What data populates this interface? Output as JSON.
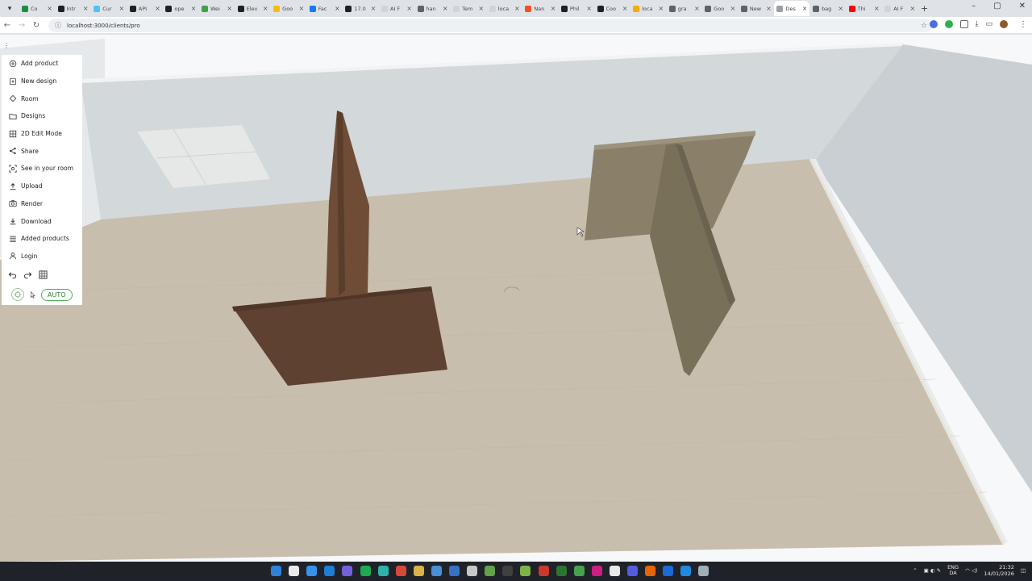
{
  "browser": {
    "tabs": [
      {
        "label": "Co",
        "color": "#1e8e3e"
      },
      {
        "label": "Intr",
        "color": "#202124"
      },
      {
        "label": "Cur",
        "color": "#4fc3f7"
      },
      {
        "label": "API",
        "color": "#202124"
      },
      {
        "label": "ope",
        "color": "#202124"
      },
      {
        "label": "Wei",
        "color": "#43a047"
      },
      {
        "label": "Elev",
        "color": "#202124"
      },
      {
        "label": "Goo",
        "color": "#fbbc04"
      },
      {
        "label": "Fac",
        "color": "#1877f2"
      },
      {
        "label": "17.0",
        "color": "#202124"
      },
      {
        "label": "AI F",
        "color": "#cfd4da"
      },
      {
        "label": "han",
        "color": "#5f6368"
      },
      {
        "label": "Tem",
        "color": "#cfd4da"
      },
      {
        "label": "loca",
        "color": "#cfd4da"
      },
      {
        "label": "Nan",
        "color": "#f4511e"
      },
      {
        "label": "Phil",
        "color": "#202124"
      },
      {
        "label": "Coo",
        "color": "#202124"
      },
      {
        "label": "loca",
        "color": "#f9ab00"
      },
      {
        "label": "gra",
        "color": "#5f6368"
      },
      {
        "label": "Goo",
        "color": "#5f6368"
      },
      {
        "label": "New",
        "color": "#5f6368"
      },
      {
        "label": "Des",
        "color": "#9aa0a6",
        "active": true
      },
      {
        "label": "bag",
        "color": "#5f6368"
      },
      {
        "label": "Thi",
        "color": "#ff0000"
      },
      {
        "label": "AI F",
        "color": "#cfd4da"
      }
    ],
    "url": "localhost:3000/clients/pro",
    "new_tab": "+",
    "window_controls": {
      "minimize": "–",
      "maximize": "▢",
      "close": "✕"
    }
  },
  "sidemenu": {
    "items": [
      {
        "label": "Add product",
        "icon": "plus-circle-icon"
      },
      {
        "label": "New design",
        "icon": "doc-plus-icon"
      },
      {
        "label": "Room",
        "icon": "home-icon"
      },
      {
        "label": "Designs",
        "icon": "folder-icon"
      },
      {
        "label": "2D Edit Mode",
        "icon": "grid-edit-icon"
      },
      {
        "label": "Share",
        "icon": "share-icon"
      },
      {
        "label": "See in your room",
        "icon": "camera-scan-icon"
      },
      {
        "label": "Upload",
        "icon": "upload-icon"
      },
      {
        "label": "Render",
        "icon": "camera-icon"
      },
      {
        "label": "Download",
        "icon": "download-icon"
      },
      {
        "label": "Added products",
        "icon": "list-icon"
      },
      {
        "label": "Login",
        "icon": "user-icon"
      }
    ],
    "tools": [
      "undo-icon",
      "redo-icon",
      "grid-icon"
    ],
    "mode_label": "AUTO",
    "drag_handle": "⋮"
  },
  "scene": {
    "floor_color": "#c7bcac",
    "wall_color": "#d4d8da",
    "objects": [
      {
        "name": "brown-panel-structure",
        "color": "#6b4a34"
      },
      {
        "name": "olive-panel-structure",
        "color": "#877d66"
      }
    ]
  },
  "taskbar": {
    "lang_top": "ENG",
    "lang_bottom": "DA",
    "time": "21:32",
    "date": "14/01/2026"
  }
}
